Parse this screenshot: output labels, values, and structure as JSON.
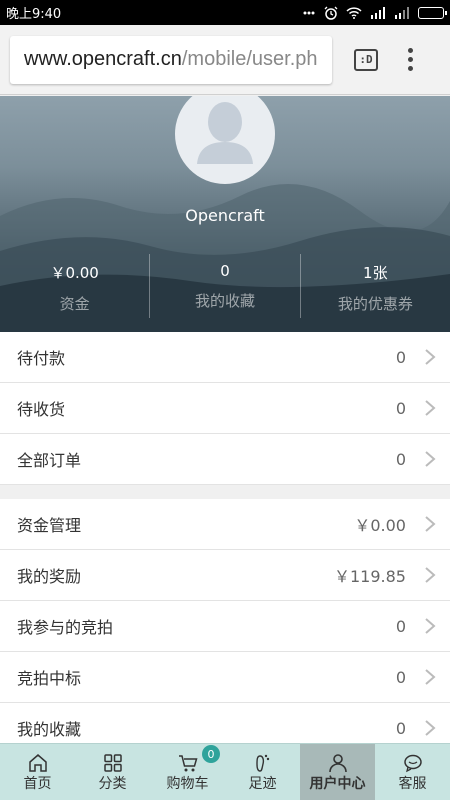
{
  "status_bar": {
    "time": "晚上9:40"
  },
  "browser": {
    "url_host": "www.opencraft.cn",
    "url_path": "/mobile/user.ph",
    "tabs_label": ":D"
  },
  "profile": {
    "username": "Opencraft",
    "stats": [
      {
        "value": "￥0.00",
        "label": "资金"
      },
      {
        "value": "0",
        "label": "我的收藏"
      },
      {
        "value": "1张",
        "label": "我的优惠券"
      }
    ]
  },
  "orders": [
    {
      "label": "待付款",
      "value": "0"
    },
    {
      "label": "待收货",
      "value": "0"
    },
    {
      "label": "全部订单",
      "value": "0"
    }
  ],
  "account": [
    {
      "label": "资金管理",
      "value": "￥0.00"
    },
    {
      "label": "我的奖励",
      "value": "￥119.85"
    },
    {
      "label": "我参与的竞拍",
      "value": "0"
    },
    {
      "label": "竞拍中标",
      "value": "0"
    },
    {
      "label": "我的收藏",
      "value": "0"
    }
  ],
  "bottom_nav": {
    "cart_badge": "0",
    "items": [
      {
        "label": "首页",
        "icon": "home-icon"
      },
      {
        "label": "分类",
        "icon": "grid-icon"
      },
      {
        "label": "购物车",
        "icon": "cart-icon"
      },
      {
        "label": "足迹",
        "icon": "footprint-icon"
      },
      {
        "label": "用户中心",
        "icon": "user-icon"
      },
      {
        "label": "客服",
        "icon": "chat-icon"
      }
    ],
    "active": "用户中心"
  },
  "colors": {
    "nav_bg": "#c8e4e1",
    "nav_active": "#a8b9b8",
    "badge": "#2fa39b"
  }
}
